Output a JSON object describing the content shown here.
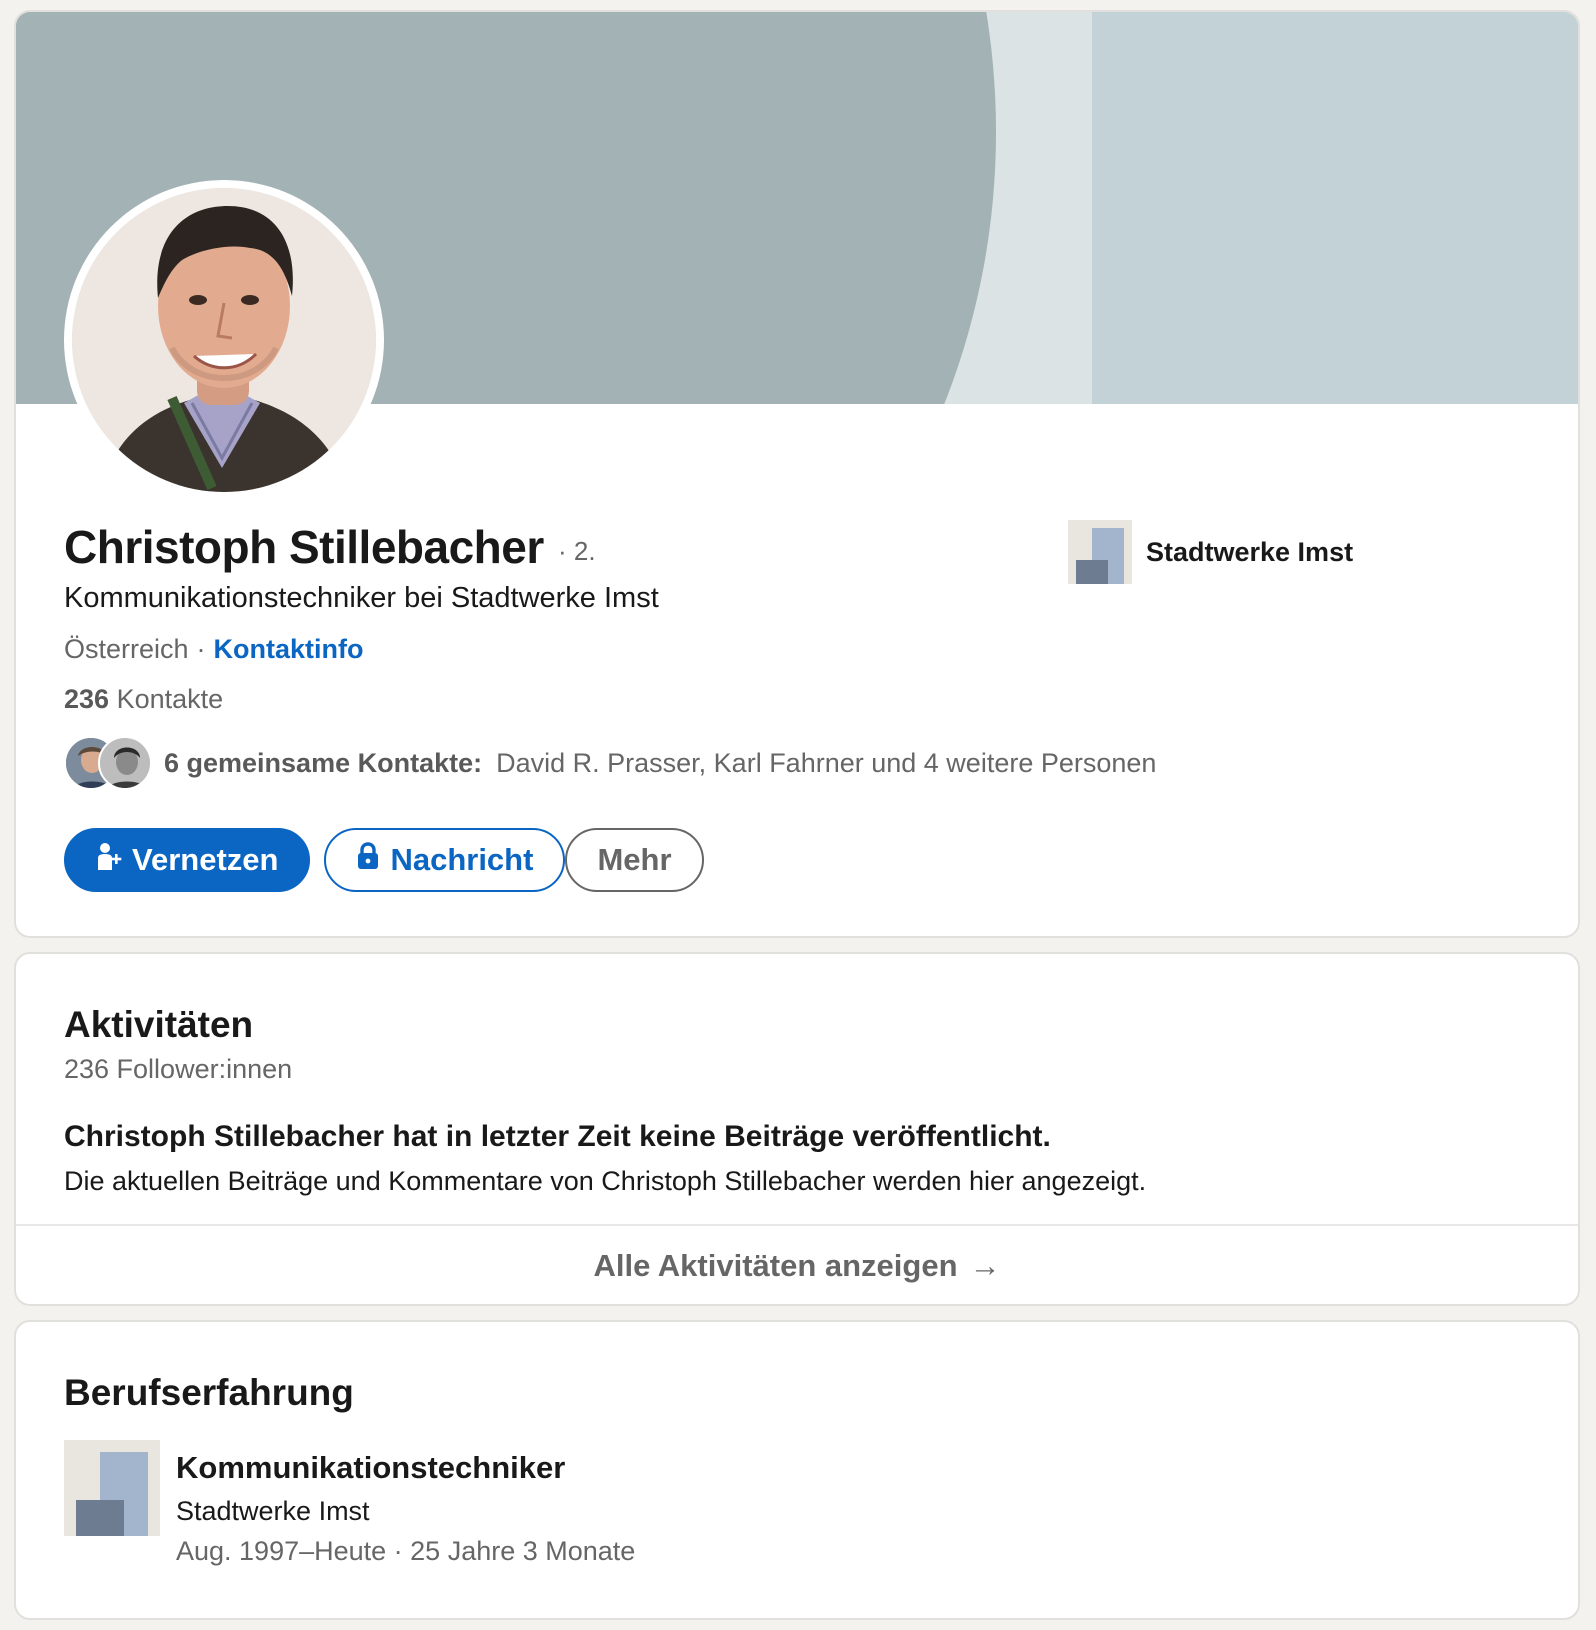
{
  "profile": {
    "name": "Christoph Stillebacher",
    "degree": "· 2.",
    "headline": "Kommunikationstechniker bei Stadtwerke Imst",
    "location": "Österreich",
    "separator": "·",
    "contact_info_link": "Kontaktinfo",
    "connections_count": "236",
    "connections_label": "Kontakte",
    "mutual_label": "6 gemeinsame Kontakte:",
    "mutual_names": "David R. Prasser, Karl Fahrner und 4 weitere Personen",
    "current_company": "Stadtwerke Imst"
  },
  "actions": {
    "connect_label": "Vernetzen",
    "message_label": "Nachricht",
    "more_label": "Mehr"
  },
  "activity": {
    "title": "Aktivitäten",
    "followers": "236 Follower:innen",
    "empty_title": "Christoph Stillebacher hat in letzter Zeit keine Beiträge veröffentlicht.",
    "empty_subtitle": "Die aktuellen Beiträge und Kommentare von Christoph Stillebacher werden hier angezeigt.",
    "show_all_label": "Alle Aktivitäten anzeigen",
    "show_all_arrow": "→"
  },
  "experience": {
    "title": "Berufserfahrung",
    "items": [
      {
        "role": "Kommunikationstechniker",
        "company": "Stadtwerke Imst",
        "dates": "Aug. 1997–Heute · 25 Jahre 3 Monate"
      }
    ]
  },
  "colors": {
    "accent": "#0a66c2",
    "banner_light": "#c3d2d6",
    "banner_dark": "#a3b2b5",
    "page_bg": "#f4f2ee"
  },
  "icons": [
    "person-add-icon",
    "lock-icon",
    "arrow-right-icon",
    "company-logo-icon"
  ]
}
